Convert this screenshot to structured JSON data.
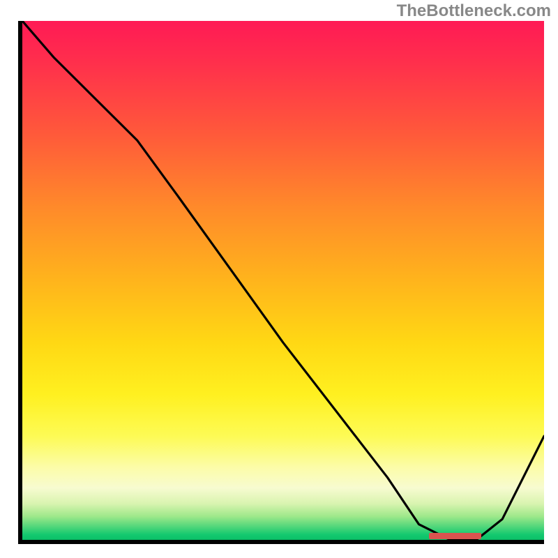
{
  "watermark": "TheBottleneck.com",
  "colors": {
    "axis": "#000000",
    "curve": "#000000",
    "marker": "#d9534f",
    "gradient_top": "#ff1a55",
    "gradient_bottom": "#0bbf67"
  },
  "chart_data": {
    "type": "line",
    "title": "",
    "xlabel": "",
    "ylabel": "",
    "xlim": [
      0,
      100
    ],
    "ylim": [
      0,
      100
    ],
    "grid": false,
    "background": "vertical-gradient red→green (low y = optimal)",
    "series": [
      {
        "name": "bottleneck-curve",
        "x": [
          0,
          6,
          14,
          22,
          30,
          40,
          50,
          60,
          70,
          76,
          82,
          87,
          92,
          100
        ],
        "y": [
          100,
          93,
          85,
          77,
          66,
          52,
          38,
          25,
          12,
          3,
          0,
          0,
          4,
          20
        ]
      }
    ],
    "annotations": [
      {
        "name": "optimal-range-marker",
        "type": "segment",
        "x0": 78,
        "x1": 88,
        "y": 0.8,
        "color": "#d9534f"
      }
    ],
    "note": "x/y are on a 0–100 normalized scale read from the unlabeled axes; y=0 is the bottom (green / no bottleneck), y=100 is the top (red / severe bottleneck)."
  }
}
